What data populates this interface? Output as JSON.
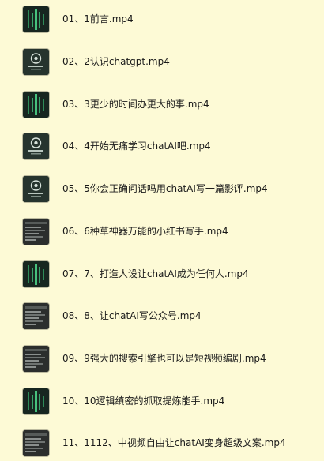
{
  "files": [
    {
      "name": "01、1前言.mp4",
      "thumb": "green-bars-video-thumbnail"
    },
    {
      "name": "02、2认识chatgpt.mp4",
      "thumb": "chatgpt-logo-video-thumbnail"
    },
    {
      "name": "03、3更少的时间办更大的事.mp4",
      "thumb": "green-bars-video-thumbnail"
    },
    {
      "name": "04、4开始无痛学习chatAI吧.mp4",
      "thumb": "chatgpt-logo-video-thumbnail"
    },
    {
      "name": "05、5你会正确问话吗用chatAI写一篇影评.mp4",
      "thumb": "chatgpt-logo-video-thumbnail"
    },
    {
      "name": "06、6种草神器万能的小红书写手.mp4",
      "thumb": "screen-recording-video-thumbnail"
    },
    {
      "name": "07、7、打造人设让chatAI成为任何人.mp4",
      "thumb": "green-bars-video-thumbnail"
    },
    {
      "name": "08、8、让chatAI写公众号.mp4",
      "thumb": "screen-recording-video-thumbnail"
    },
    {
      "name": "09、9强大的搜索引擎也可以是短视频编剧.mp4",
      "thumb": "screen-recording-video-thumbnail"
    },
    {
      "name": "10、10逻辑缜密的抓取提炼能手.mp4",
      "thumb": "green-bars-video-thumbnail"
    },
    {
      "name": "11、1112、中视频自由让chatAI变身超级文案.mp4",
      "thumb": "screen-recording-video-thumbnail"
    }
  ]
}
